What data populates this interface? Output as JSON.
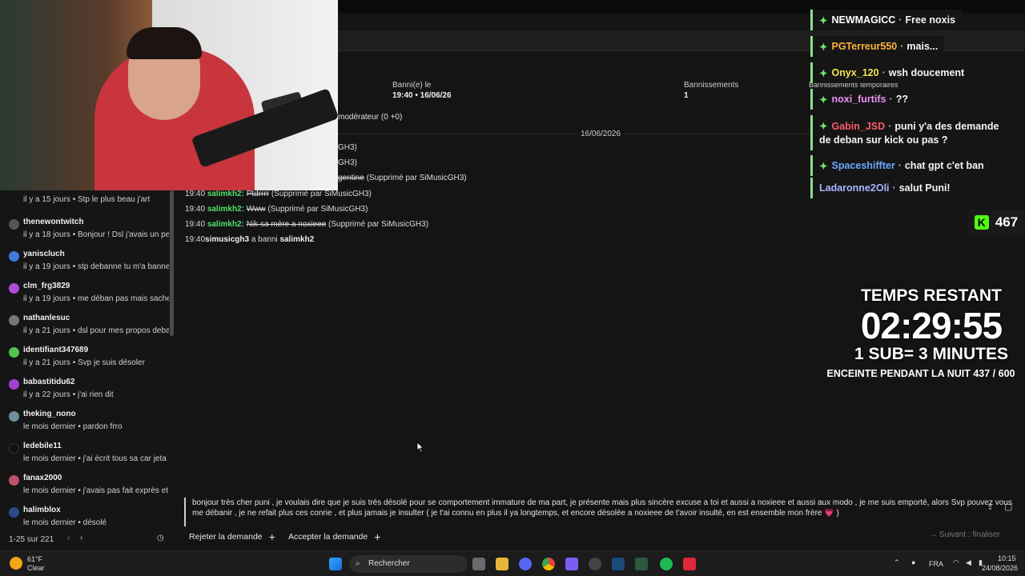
{
  "overlay": {
    "chat": [
      {
        "user": "NEWMAGICC",
        "color": "#ffffff",
        "message": "Free noxis",
        "star": true
      },
      {
        "user": "PGTerreur550",
        "color": "#ffb23a",
        "message": "mais...",
        "star": true
      },
      {
        "user": "Onyx_120",
        "color": "#f5e34a",
        "message": "wsh doucement",
        "star": true
      },
      {
        "user": "noxi_furtifs",
        "color": "#e98ef2",
        "message": "??",
        "star": true
      },
      {
        "user": "Gabin_JSD",
        "color": "#ff5a6a",
        "message": "puni y'a des demande de deban sur kick ou pas ?",
        "star": true
      },
      {
        "user": "Spaceshiffter",
        "color": "#6aa8ff",
        "message": "chat gpt c'et ban",
        "star": true
      },
      {
        "user": "Ladaronne2Oli",
        "color": "#a7b6ff",
        "message": "salut Puni!",
        "star": false
      }
    ],
    "kick_count": "467",
    "kick_letter": "K",
    "timer_title": "TEMPS RESTANT",
    "timer_value": "02:29:55",
    "timer_rule": "1 SUB= 3 MINUTES",
    "timer_goal": "ENCEINTE PENDANT LA NUIT 437 / 600"
  },
  "header": {
    "banned_label": "Banni(e) le",
    "banned_value": "19:40 • 16/06/26",
    "bans_label": "Bannissements",
    "bans_value": "1",
    "temp_bans_label": "Bannissements temporaires",
    "moderator_text": "modérateur (0 +0)"
  },
  "log": {
    "date": "16/06/2026",
    "partial": [
      {
        "text": "GH3)"
      },
      {
        "text": "GH3)"
      },
      {
        "strike": "gentine",
        "rest": " (Supprimé par SiMusicGH3)"
      }
    ],
    "entries": [
      {
        "time": "19:40",
        "user": "salimkh2:",
        "deleted": "Ptdrrrr",
        "note": " (Supprimé par SiMusicGH3)"
      },
      {
        "time": "19:40",
        "user": "salimkh2:",
        "deleted": "Www",
        "note": " (Supprimé par SiMusicGH3)"
      },
      {
        "time": "19:40",
        "user": "salimkh2:",
        "deleted": "Nik sa mère a noxieee",
        "note": " (Supprimé par SiMusicGH3)"
      }
    ],
    "ban": {
      "time": "19:40",
      "mod": "simusicgh3",
      "action": " a banni ",
      "target": "salimkh2"
    }
  },
  "sidebar": {
    "first_sub": "il y a 15 jours • Stp le plus beau j'art",
    "items": [
      {
        "name": "thenewontwitch",
        "sub": "il y a 18 jours • Bonjour ! Dsl j'avais un pe",
        "avatar": "#555555"
      },
      {
        "name": "yaniscluch",
        "sub": "il y a 19 jours • stp debanne tu m'a banne",
        "avatar": "#3d7bd9"
      },
      {
        "name": "clm_frg3829",
        "sub": "il y a 19 jours • me déban pas mais sache",
        "avatar": "#b04ad8"
      },
      {
        "name": "nathanlesuc",
        "sub": "il y a 21 jours • dsl pour mes propos deba",
        "avatar": "#777777"
      },
      {
        "name": "identifiant347689",
        "sub": "il y a 21 jours • Svp je suis désoler",
        "avatar": "#53c24a"
      },
      {
        "name": "babastitidu62",
        "sub": "il y a 22 jours • j'ai rien dit",
        "avatar": "#a340d0"
      },
      {
        "name": "theking_nono",
        "sub": "le mois dernier • pardon frro",
        "avatar": "#6f8fa0"
      },
      {
        "name": "ledebile11",
        "sub": "le mois dernier • j'ai écrit tous sa car jeta",
        "avatar": "#111111"
      },
      {
        "name": "fanax2000",
        "sub": "le mois dernier • j'avais pas fait exprès et",
        "avatar": "#c0506a"
      },
      {
        "name": "halimblox",
        "sub": "le mois dernier • désolé",
        "avatar": "#2a4a8a"
      }
    ],
    "pagination": "1-25 sur 221"
  },
  "request": {
    "message": "bonjour très cher puni , je voulais dire que je suis très désolé pour se comportement immature de ma part, je présente mais plus sincère excuse a toi et aussi a noxieee et aussi aux modo , je me suis emporté, alors Svp pouvez vous me débanir , je ne refait plus ces conrie , et plus jamais je insulter ( je t'ai connu en plus il ya longtemps, et encore désolée a noxieee de t'avoir insulté, en est ensemble mon frère 💗 )",
    "reject_label": "Rejeter la demande",
    "accept_label": "Accepter la demande",
    "finalize_label": "Suivant : finaliser"
  },
  "taskbar": {
    "temp": "61°F",
    "weather": "Clear",
    "search_placeholder": "Rechercher",
    "lang": "FRA",
    "time": "10:15",
    "date": "24/08/2026"
  }
}
